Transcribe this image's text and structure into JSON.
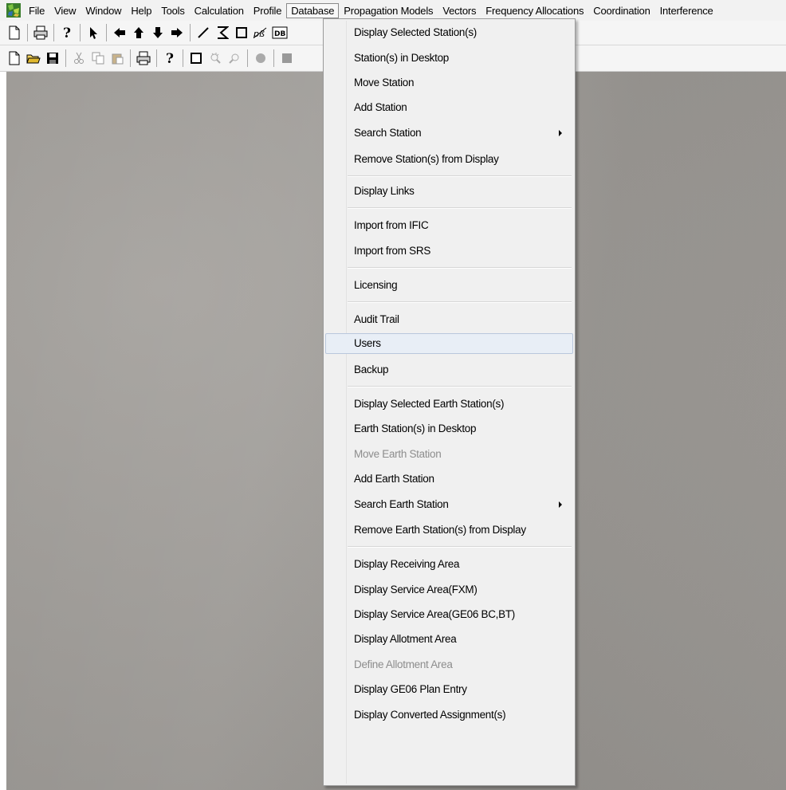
{
  "menubar": {
    "items": [
      "File",
      "View",
      "Window",
      "Help",
      "Tools",
      "Calculation",
      "Profile",
      "Database",
      "Propagation Models",
      "Vectors",
      "Frequency Allocations",
      "Coordination",
      "Interference"
    ],
    "active_index": 7
  },
  "toolbar1": {
    "icons": [
      "new-document-icon",
      "print-icon",
      "help-icon",
      "select-arrow-icon",
      "arrow-left-icon",
      "arrow-up-icon",
      "arrow-down-icon",
      "arrow-right-icon",
      "line-icon",
      "polyline-icon",
      "rectangle-icon",
      "measure-icon",
      "database-icon"
    ],
    "db_label": "DB"
  },
  "toolbar2": {
    "icons": [
      "new-file-icon",
      "open-folder-icon",
      "save-icon",
      "cut-icon",
      "copy-icon",
      "paste-icon",
      "print-icon",
      "help-icon",
      "square-icon",
      "zoom-in-icon",
      "zoom-out-icon",
      "circle-icon",
      "fill-icon"
    ]
  },
  "dropdown": {
    "items": [
      {
        "label": "Display Selected Station(s)",
        "disabled": false,
        "submenu": false
      },
      {
        "label": "Station(s) in Desktop",
        "disabled": false,
        "submenu": false
      },
      {
        "label": "Move Station",
        "disabled": false,
        "submenu": false
      },
      {
        "label": "Add Station",
        "disabled": false,
        "submenu": false
      },
      {
        "label": "Search Station",
        "disabled": false,
        "submenu": true
      },
      {
        "label": "Remove Station(s) from Display",
        "disabled": false,
        "submenu": false
      },
      {
        "label": "Display Links",
        "disabled": false,
        "submenu": false
      },
      {
        "label": "Import from IFIC",
        "disabled": false,
        "submenu": false
      },
      {
        "label": "Import from SRS",
        "disabled": false,
        "submenu": false
      },
      {
        "label": "Licensing",
        "disabled": false,
        "submenu": false
      },
      {
        "label": "Audit Trail",
        "disabled": false,
        "submenu": false
      },
      {
        "label": "Users",
        "disabled": false,
        "submenu": false,
        "hovered": true
      },
      {
        "label": "Backup",
        "disabled": false,
        "submenu": false
      },
      {
        "label": "Display Selected Earth Station(s)",
        "disabled": false,
        "submenu": false
      },
      {
        "label": "Earth Station(s) in Desktop",
        "disabled": false,
        "submenu": false
      },
      {
        "label": "Move Earth Station",
        "disabled": true,
        "submenu": false
      },
      {
        "label": "Add Earth Station",
        "disabled": false,
        "submenu": false
      },
      {
        "label": "Search Earth Station",
        "disabled": false,
        "submenu": true
      },
      {
        "label": "Remove Earth Station(s) from Display",
        "disabled": false,
        "submenu": false
      },
      {
        "label": "Display Receiving Area",
        "disabled": false,
        "submenu": false
      },
      {
        "label": "Display Service Area(FXM)",
        "disabled": false,
        "submenu": false
      },
      {
        "label": "Display Service Area(GE06 BC,BT)",
        "disabled": false,
        "submenu": false
      },
      {
        "label": "Display Allotment Area",
        "disabled": false,
        "submenu": false
      },
      {
        "label": "Define Allotment Area",
        "disabled": true,
        "submenu": false
      },
      {
        "label": "Display GE06 Plan Entry",
        "disabled": false,
        "submenu": false
      },
      {
        "label": "Display Converted Assignment(s)",
        "disabled": false,
        "submenu": false
      }
    ]
  },
  "colors": {
    "menu_bg": "#f0f0f0",
    "desktop_bg": "#9a9793",
    "hover_bg": "#e8eef6",
    "disabled_text": "#8d8d8d"
  }
}
